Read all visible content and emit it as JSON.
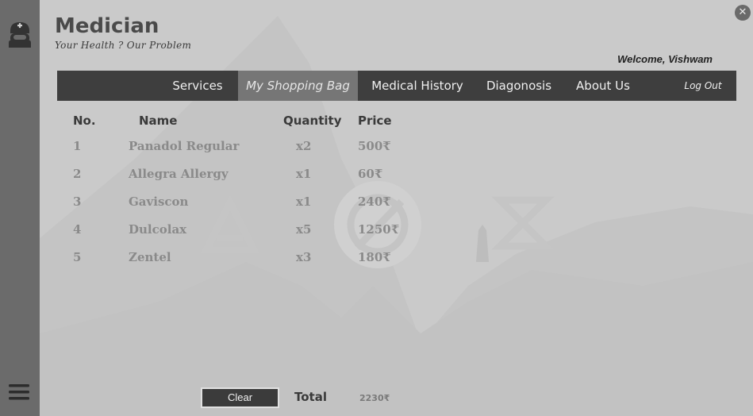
{
  "app": {
    "title": "Medician",
    "subtitle": "Your Health ? Our Problem",
    "welcome": "Welcome, Vishwam",
    "close_glyph": "✕"
  },
  "icons": {
    "sidebar_top": "nurse-icon",
    "sidebar_bottom": "hamburger-menu-icon",
    "close": "close-icon"
  },
  "nav": {
    "services": "Services",
    "shopping_bag": "My Shopping Bag",
    "medical_history": "Medical History",
    "diagnosis": "Diagonosis",
    "about": "About Us",
    "logout": "Log Out",
    "active": "shopping_bag"
  },
  "table": {
    "headers": {
      "no": "No.",
      "name": "Name",
      "quantity": "Quantity",
      "price": "Price"
    },
    "rows": [
      {
        "no": "1",
        "name": "Panadol Regular",
        "quantity": "x2",
        "price": "500₹"
      },
      {
        "no": "2",
        "name": "Allegra Allergy",
        "quantity": "x1",
        "price": "60₹"
      },
      {
        "no": "3",
        "name": "Gaviscon",
        "quantity": "x1",
        "price": "240₹"
      },
      {
        "no": "4",
        "name": "Dulcolax",
        "quantity": "x5",
        "price": "1250₹"
      },
      {
        "no": "5",
        "name": "Zentel",
        "quantity": "x3",
        "price": "180₹"
      }
    ]
  },
  "footer": {
    "clear_label": "Clear",
    "total_label": "Total",
    "total_value": "2230₹"
  },
  "colors": {
    "sidebar": "#6b6b6b",
    "navbar": "#3e3e3e",
    "nav_active": "#767676",
    "background": "#cacaca"
  }
}
